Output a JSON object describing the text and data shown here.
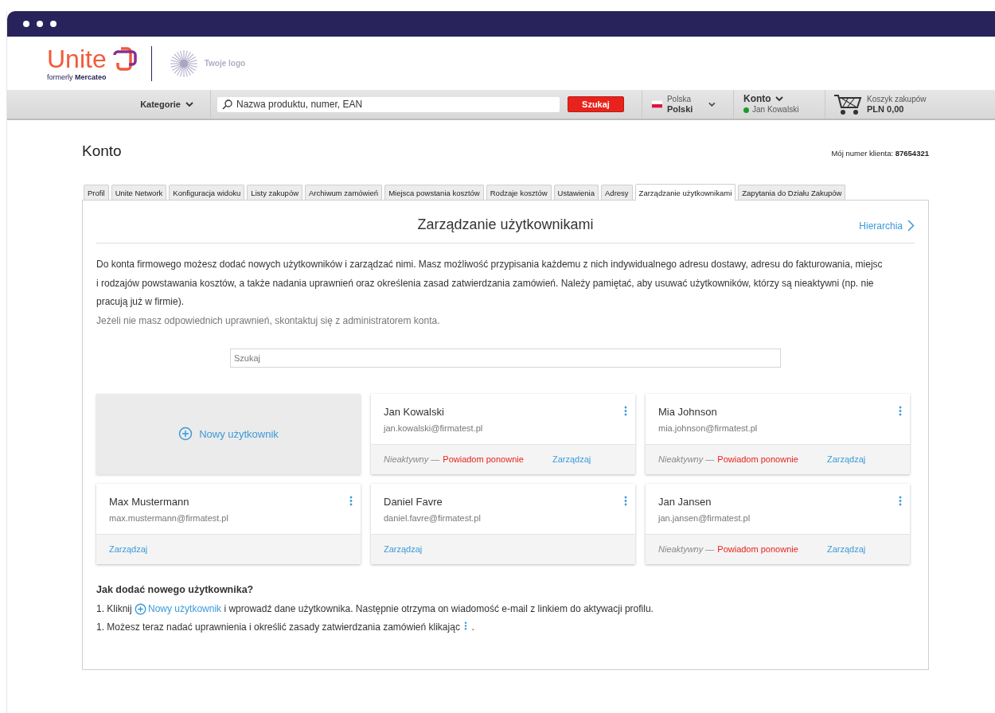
{
  "header": {
    "brand": "Unite",
    "tagline": "formerly **Mercateo**",
    "partner_logo": "Twoje logo"
  },
  "nav": {
    "categories": "Kategorie",
    "search": {
      "placeholder": "Nazwa produktu, numer, EAN"
    },
    "search_button": "Szukaj",
    "country": "Polska",
    "language": "Polski",
    "account": "Konto",
    "user": "Jan Kowalski",
    "cart_label": "Koszyk zakupów",
    "cart_total": "PLN 0,00"
  },
  "page": {
    "title": "Konto",
    "customer_number": "Mój numer klienta: **87654321**"
  },
  "tabs": [
    {
      "label": "Profil",
      "selected": false
    },
    {
      "label": "Unite Network",
      "selected": false
    },
    {
      "label": "Konfiguracja widoku",
      "selected": false
    },
    {
      "label": "Listy zakupów",
      "selected": false
    },
    {
      "label": "Archiwum zamówień",
      "selected": false
    },
    {
      "label": "Miejsca powstania kosztów",
      "selected": false
    },
    {
      "label": "Rodzaje kosztów",
      "selected": false
    },
    {
      "label": "Ustawienia",
      "selected": false
    },
    {
      "label": "Adresy",
      "selected": false
    },
    {
      "label": "Zarządzanie użytkownikami",
      "selected": true
    },
    {
      "label": "Zapytania do Działu Zakupów",
      "selected": false
    }
  ],
  "section": {
    "title": "Zarządzanie użytkownikami",
    "hierarchy_link": "Hierarchia",
    "description": "Do konta firmowego możesz dodać nowych użytkowników i zarządzać nimi. Masz możliwość przypisania każdemu z nich indywidualnego adresu dostawy, adresu do fakturowania, miejsc i rodzajów powstawania kosztów, a także nadania uprawnień oraz określenia zasad zatwierdzania zamówień. Należy pamiętać, aby usuwać użytkowników, którzy są nieaktywni (np. nie pracują już w firmie).",
    "note": "Jeżeli nie masz odpowiednich uprawnień, skontaktuj się z administratorem konta.",
    "search": {
      "placeholder": "Szukaj"
    },
    "new_user": "Nowy użytkownik"
  },
  "users": [
    {
      "name": "Jan Kowalski",
      "email": "jan.kowalski@firmatest.pl",
      "inactive": true,
      "status": "Nieaktywny",
      "separator": "—",
      "resend": "Powiadom ponownie",
      "manage": "Zarządzaj"
    },
    {
      "name": "Mia Johnson",
      "email": "mia.johnson@firmatest.pl",
      "inactive": true,
      "status": "Nieaktywny",
      "separator": "—",
      "resend": "Powiadom ponownie",
      "manage": "Zarządzaj"
    },
    {
      "name": "Max Mustermann",
      "email": "max.mustermann@firmatest.pl",
      "inactive": false,
      "manage": "Zarządzaj"
    },
    {
      "name": "Daniel Favre",
      "email": "daniel.favre@firmatest.pl",
      "inactive": false,
      "manage": "Zarządzaj"
    },
    {
      "name": "Jan Jansen",
      "email": "jan.jansen@firmatest.pl",
      "inactive": true,
      "status": "Nieaktywny",
      "separator": "—",
      "resend": "Powiadom ponownie",
      "manage": "Zarządzaj"
    }
  ],
  "help": {
    "title": "Jak dodać nowego użytkownika?",
    "steps": [
      {
        "kind": "link",
        "before": "1. Kliknij",
        "link": "Nowy użytkownik",
        "after": "i wprowadź dane użytkownika. Następnie otrzyma on wiadomość e-mail z linkiem do aktywacji profilu."
      },
      {
        "kind": "menu",
        "before": "1. Możesz teraz nadać uprawnienia i określić zasady zatwierdzania zamówień klikając",
        "after": "."
      }
    ]
  }
}
